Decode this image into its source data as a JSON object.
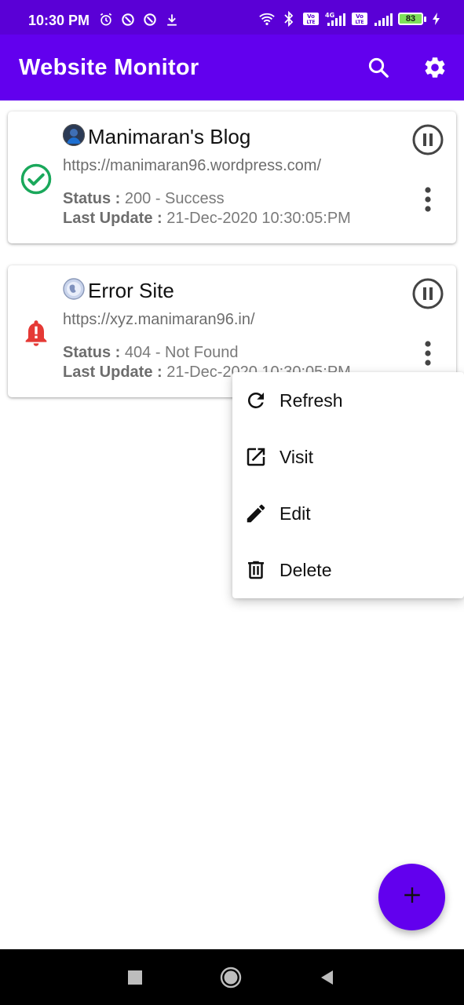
{
  "status_bar": {
    "time": "10:30 PM",
    "left_icons": [
      "alarm-icon",
      "data-saver-icon",
      "data-saver-icon",
      "download-icon"
    ],
    "right_icons": [
      "wifi-icon",
      "bluetooth-icon",
      "volte-icon",
      "signal-4g-icon",
      "volte-icon",
      "signal-icon"
    ],
    "battery": "83",
    "network_label": "4G",
    "volte_label": "Vo LTE"
  },
  "app_bar": {
    "title": "Website Monitor",
    "actions": [
      "search-icon",
      "settings-icon"
    ]
  },
  "colors": {
    "primary": "#6200ee",
    "status_bar": "#5a00d6",
    "success": "#1aa85b",
    "error": "#e53935",
    "text_secondary": "#6d6d6d"
  },
  "sites": [
    {
      "title": "Manimaran's Blog",
      "url": "https://manimaran96.wordpress.com/",
      "status_label": "Status :",
      "status_value": "200 - Success",
      "update_label": "Last Update :",
      "update_value": "21-Dec-2020 10:30:05:PM",
      "status_icon": "check-circle-icon",
      "state": "success"
    },
    {
      "title": "Error Site",
      "url": "https://xyz.manimaran96.in/",
      "status_label": "Status :",
      "status_value": "404 - Not Found",
      "update_label": "Last Update :",
      "update_value": "21-Dec-2020 10:30:05:PM",
      "status_icon": "alert-bell-icon",
      "state": "error"
    }
  ],
  "context_menu": {
    "items": [
      {
        "label": "Refresh",
        "icon": "refresh-icon"
      },
      {
        "label": "Visit",
        "icon": "open-in-new-icon"
      },
      {
        "label": "Edit",
        "icon": "edit-icon"
      },
      {
        "label": "Delete",
        "icon": "delete-icon"
      }
    ]
  },
  "fab": {
    "icon": "plus-icon"
  },
  "nav_bar": {
    "buttons": [
      "recents-icon",
      "home-icon",
      "back-icon"
    ]
  }
}
